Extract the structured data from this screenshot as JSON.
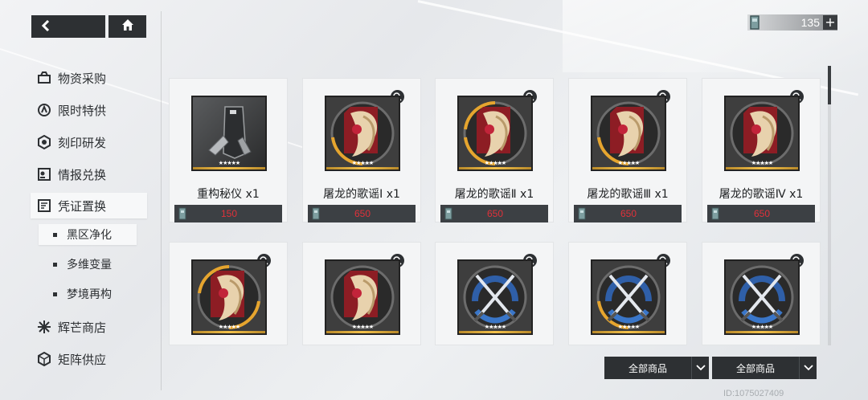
{
  "header": {
    "back_icon": "back-arrow-icon",
    "home_icon": "home-icon"
  },
  "currency": {
    "icon": "token-icon",
    "value": "135",
    "add_label": "+"
  },
  "sidebar": {
    "items": [
      {
        "label": "物资采购",
        "icon": "supply-icon"
      },
      {
        "label": "限时特供",
        "icon": "limited-icon"
      },
      {
        "label": "刻印研发",
        "icon": "imprint-icon"
      },
      {
        "label": "情报兑换",
        "icon": "intel-icon"
      },
      {
        "label": "凭证置换",
        "icon": "voucher-icon",
        "active": true
      },
      {
        "label": "辉芒商店",
        "icon": "radiance-icon"
      },
      {
        "label": "矩阵供应",
        "icon": "matrix-icon"
      }
    ],
    "sub_items": [
      {
        "label": "黑区净化",
        "active": true
      },
      {
        "label": "多维变量"
      },
      {
        "label": "梦境再构"
      }
    ]
  },
  "items": [
    {
      "name": "重构秘仪 x1",
      "price": "150",
      "art": "device",
      "stars": "★★★★★"
    },
    {
      "name": "屠龙的歌谣Ⅰ x1",
      "price": "650",
      "art": "dragon",
      "stars": "★★★★★"
    },
    {
      "name": "屠龙的歌谣Ⅱ x1",
      "price": "650",
      "art": "dragon",
      "stars": "★★★★★"
    },
    {
      "name": "屠龙的歌谣Ⅲ x1",
      "price": "650",
      "art": "dragon",
      "stars": "★★★★★"
    },
    {
      "name": "屠龙的歌谣Ⅳ x1",
      "price": "650",
      "art": "dragon",
      "stars": "★★★★★"
    },
    {
      "name": "",
      "price": "",
      "art": "dragon",
      "stars": "★★★★★"
    },
    {
      "name": "",
      "price": "",
      "art": "dragon",
      "stars": "★★★★★"
    },
    {
      "name": "",
      "price": "",
      "art": "swords",
      "stars": "★★★★★"
    },
    {
      "name": "",
      "price": "",
      "art": "swords",
      "stars": "★★★★★"
    },
    {
      "name": "",
      "price": "",
      "art": "swords",
      "stars": "★★★★★"
    }
  ],
  "filters": [
    {
      "label": "全部商品"
    },
    {
      "label": "全部商品"
    }
  ],
  "uid": "ID:1075027409",
  "colors": {
    "dark": "#2d3033",
    "price_red": "#e0313a",
    "rarity_gold": "#f3c14b"
  }
}
